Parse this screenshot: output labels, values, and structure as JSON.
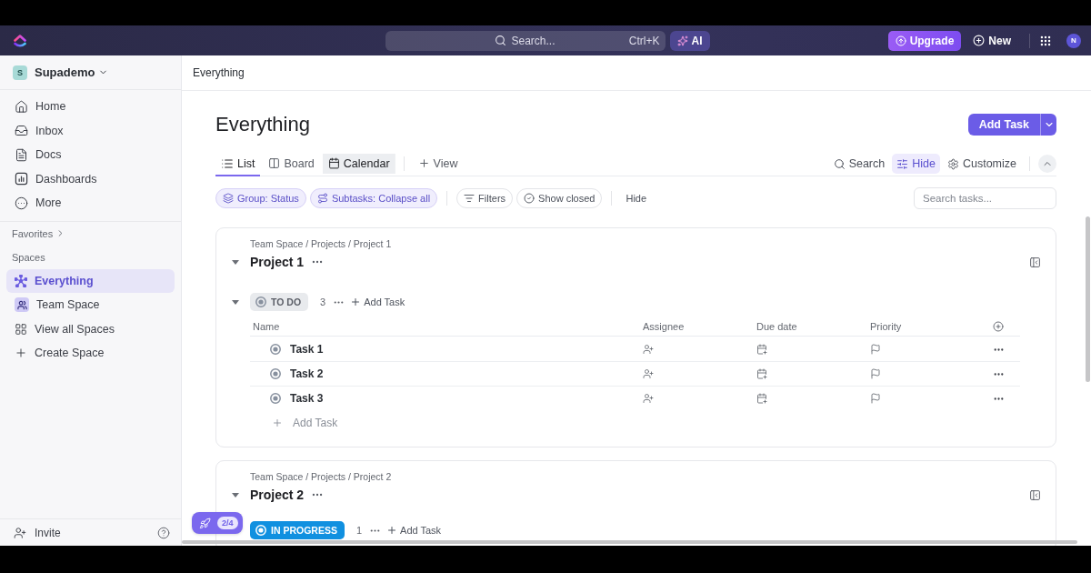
{
  "top_bar": {
    "search": {
      "label": "Search...",
      "shortcut": "Ctrl+K"
    },
    "ai_button": "AI",
    "upgrade_button": "Upgrade",
    "new_button": "New",
    "avatar": "N"
  },
  "sidebar": {
    "workspace": {
      "initial": "S",
      "name": "Supademo"
    },
    "nav_items": [
      {
        "label": "Home"
      },
      {
        "label": "Inbox"
      },
      {
        "label": "Docs"
      },
      {
        "label": "Dashboards"
      },
      {
        "label": "More"
      }
    ],
    "favorites_label": "Favorites",
    "spaces_label": "Spaces",
    "spaces": [
      {
        "label": "Everything",
        "selected": true
      },
      {
        "label": "Team Space",
        "selected": false
      },
      {
        "label": "View all Spaces",
        "selected": false
      },
      {
        "label": "Create Space",
        "selected": false
      }
    ],
    "invite": "Invite"
  },
  "breadcrumb": "Everything",
  "header": {
    "title": "Everything",
    "add_task_button": "Add Task"
  },
  "views": [
    {
      "label": "List",
      "selected": true,
      "hovered": false
    },
    {
      "label": "Board",
      "selected": false,
      "hovered": false
    },
    {
      "label": "Calendar",
      "selected": false,
      "hovered": true
    }
  ],
  "add_view": "View",
  "view_actions": [
    {
      "label": "Search",
      "active": false
    },
    {
      "label": "Hide",
      "active": true
    },
    {
      "label": "Customize",
      "active": false
    }
  ],
  "filters": [
    {
      "label": "Group: Status",
      "active": true
    },
    {
      "label": "Subtasks: Collapse all",
      "active": true
    },
    {
      "label": "Filters",
      "active": false
    },
    {
      "label": "Show closed",
      "active": false
    }
  ],
  "hide_link": "Hide",
  "search_tasks": {
    "placeholder": "Search tasks..."
  },
  "projects": [
    {
      "path": "Team Space / Projects / Project 1",
      "name": "Project 1",
      "expanded": true,
      "groups": [
        {
          "status": "TO DO",
          "kind": "not_started",
          "color": "#87909e",
          "expanded": true,
          "count": "3",
          "add_task": "Add Task",
          "columns": [
            "Name",
            "Assignee",
            "Due date",
            "Priority"
          ],
          "tasks": [
            {
              "name": "Task 1"
            },
            {
              "name": "Task 2"
            },
            {
              "name": "Task 3"
            }
          ],
          "add_task_row": "Add Task"
        }
      ]
    },
    {
      "path": "Team Space / Projects / Project 2",
      "name": "Project 2",
      "expanded": true,
      "groups": [
        {
          "status": "IN PROGRESS",
          "kind": "active",
          "color": "#1090e0",
          "count": "1",
          "add_task": "Add Task"
        }
      ]
    }
  ],
  "tour_badge": "2/4"
}
